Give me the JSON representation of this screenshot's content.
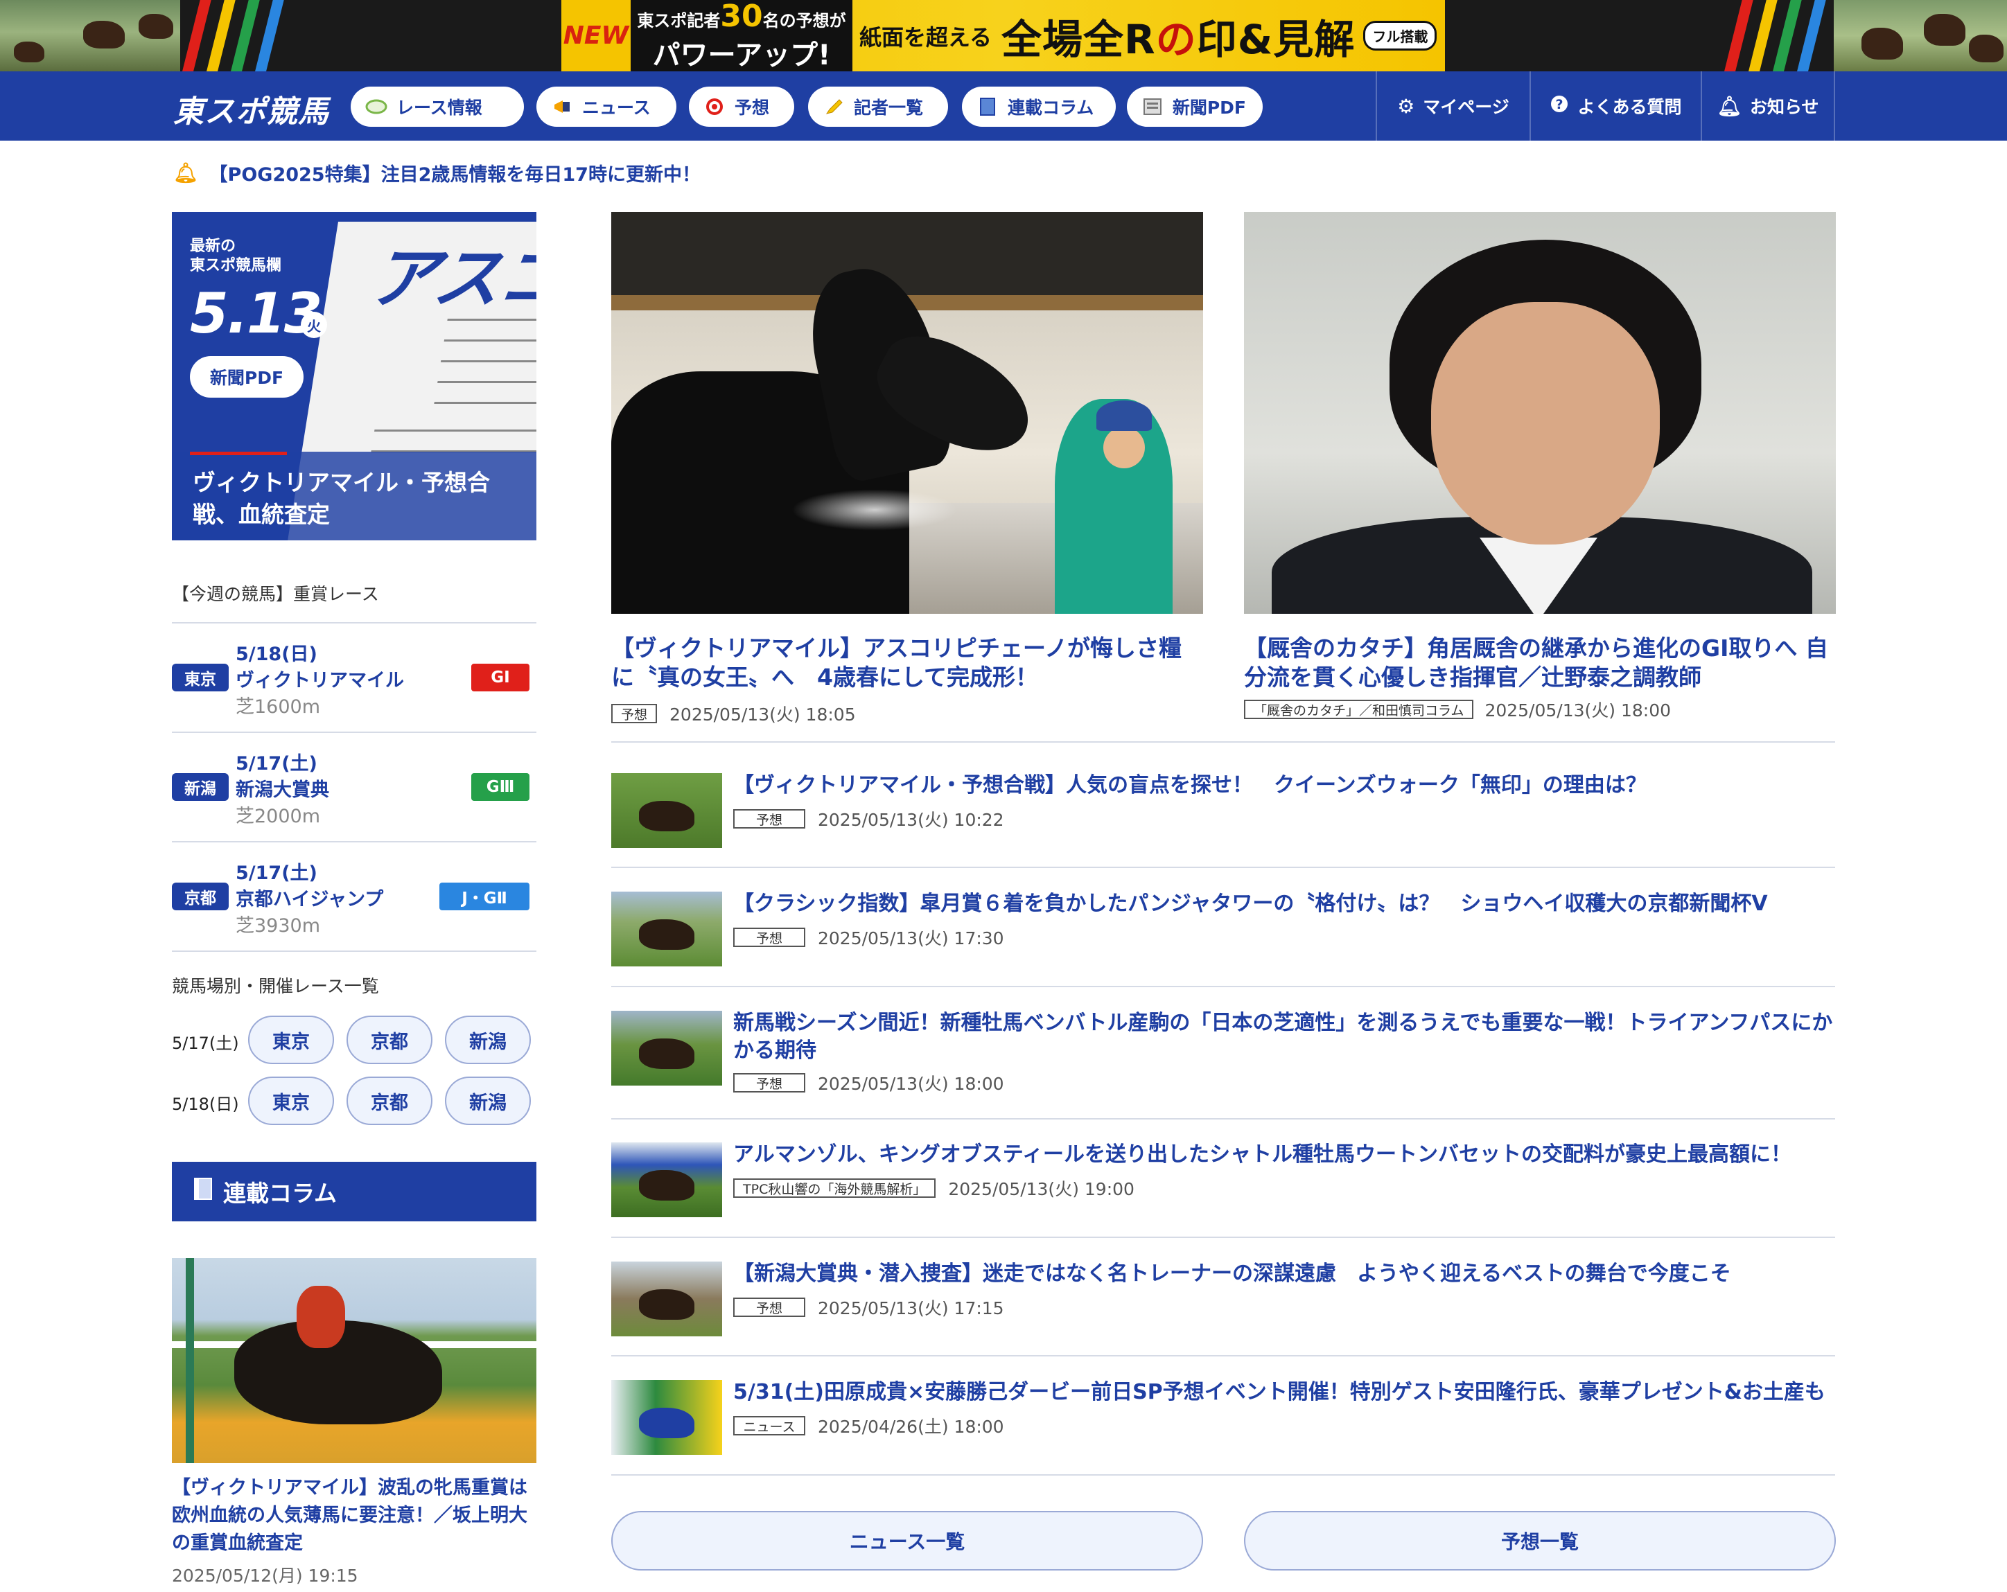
{
  "banner": {
    "new": "NEW",
    "line1_pre": "東スポ記者",
    "line1_num": "30",
    "line1_post": "名の予想が",
    "line2": "パワーアップ!",
    "sub": "紙面を超える",
    "big1": "全場全R",
    "big_mid": "の",
    "big2": "印",
    "big_amp": "&",
    "big3": "見解",
    "tag": "フル搭載"
  },
  "nav": {
    "logo": "東スポ競馬",
    "items": [
      {
        "label": "レース情報",
        "icon": "racetrack-icon"
      },
      {
        "label": "ニュース",
        "icon": "megaphone-icon"
      },
      {
        "label": "予想",
        "icon": "target-icon"
      },
      {
        "label": "記者一覧",
        "icon": "pencil-icon"
      },
      {
        "label": "連載コラム",
        "icon": "book-icon"
      },
      {
        "label": "新聞PDF",
        "icon": "newspaper-icon"
      }
    ],
    "right": [
      {
        "label": "マイページ",
        "icon": "gear-icon"
      },
      {
        "label": "よくある質問",
        "icon": "question-icon"
      },
      {
        "label": "お知らせ",
        "icon": "bell-icon"
      }
    ]
  },
  "notice": "【POG2025特集】注目2歳馬情報を毎日17時に更新中！",
  "pdf_card": {
    "small1": "最新の",
    "small2": "東スポ競馬欄",
    "date": "5.13",
    "dow": "火",
    "button": "新聞PDF",
    "paper_head": "アスコリ",
    "caption": "ヴィクトリアマイル・予想合戦、血統査定"
  },
  "weekly": {
    "heading": "【今週の競馬】重賞レース",
    "races": [
      {
        "venue": "東京",
        "date": "5/18(日)",
        "name": "ヴィクトリアマイル",
        "surface": "芝1600m",
        "grade": "GⅠ",
        "grade_color": "#e0201a"
      },
      {
        "venue": "新潟",
        "date": "5/17(土)",
        "name": "新潟大賞典",
        "surface": "芝2000m",
        "grade": "GⅢ",
        "grade_color": "#25a04a"
      },
      {
        "venue": "京都",
        "date": "5/17(土)",
        "name": "京都ハイジャンプ",
        "surface": "芝3930m",
        "grade": "J・GⅡ",
        "grade_color": "#2a86e0"
      }
    ]
  },
  "venues": {
    "heading": "競馬場別・開催レース一覧",
    "rows": [
      {
        "date": "5/17(土)",
        "buttons": [
          "東京",
          "京都",
          "新潟"
        ]
      },
      {
        "date": "5/18(日)",
        "buttons": [
          "東京",
          "京都",
          "新潟"
        ]
      }
    ]
  },
  "column": {
    "heading": "連載コラム",
    "title": "【ヴィクトリアマイル】波乱の牝馬重賞は欧州血統の人気薄馬に要注意！／坂上明大の重賞血統査定",
    "date": "2025/05/12(月)  19:15"
  },
  "heroes": [
    {
      "title": "【ヴィクトリアマイル】アスコリピチェーノが悔しさ糧に〝真の女王〟へ　4歳春にして完成形！",
      "tag": "予想",
      "date": "2025/05/13(火)  18:05"
    },
    {
      "title": "【厩舎のカタチ】角居厩舎の継承から進化のGⅠ取りへ 自分流を貫く心優しき指揮官／辻野泰之調教師",
      "tag": "「厩舎のカタチ」／和田慎司コラム",
      "date": "2025/05/13(火)  18:00"
    }
  ],
  "articles": [
    {
      "title": "【ヴィクトリアマイル・予想合戦】人気の盲点を探せ！　クイーンズウォーク「無印」の理由は？",
      "tag": "予想",
      "date": "2025/05/13(火)  10:22"
    },
    {
      "title": "【クラシック指数】皐月賞６着を負かしたパンジャタワーの〝格付け〟は？　ショウヘイ収穫大の京都新聞杯V",
      "tag": "予想",
      "date": "2025/05/13(火)  17:30"
    },
    {
      "title": "新馬戦シーズン間近！新種牡馬ベンバトル産駒の「日本の芝適性」を測るうえでも重要な一戦！トライアンフパスにかかる期待",
      "tag": "予想",
      "date": "2025/05/13(火)  18:00"
    },
    {
      "title": "アルマンゾル、キングオブスティールを送り出したシャトル種牡馬ウートンバセットの交配料が豪史上最高額に！",
      "tag": "TPC秋山響の「海外競馬解析」",
      "date": "2025/05/13(火)  19:00"
    },
    {
      "title": "【新潟大賞典・潜入捜査】迷走ではなく名トレーナーの深謀遠慮　ようやく迎えるベストの舞台で今度こそ",
      "tag": "予想",
      "date": "2025/05/13(火)  17:15"
    },
    {
      "title": "5/31(土)田原成貴×安藤勝己ダービー前日SP予想イベント開催！特別ゲスト安田隆行氏、豪華プレゼント&お土産も",
      "tag": "ニュース",
      "date": "2025/04/26(土)  18:00"
    }
  ],
  "buttons": {
    "news_list": "ニュース一覧",
    "prediction_list": "予想一覧"
  },
  "colors": {
    "brand_blue": "#1f3fa3",
    "banner_yellow": "#f5c400",
    "alert_red": "#e0201a"
  }
}
